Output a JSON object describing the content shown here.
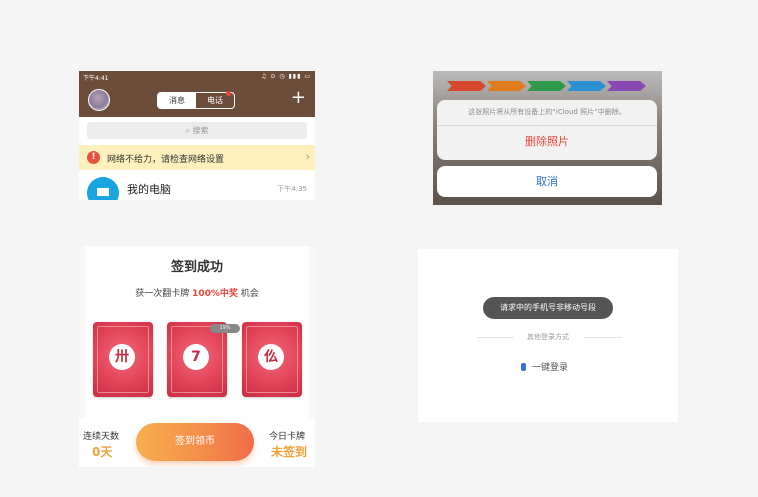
{
  "qq_panel": {
    "status_time": "下午4:41",
    "status_icons": "♫ ⊙ ◷ ▮▮▮ ▭",
    "tabs": [
      "消息",
      "电话"
    ],
    "plus_icon": "+",
    "search_placeholder": "搜索",
    "network_alert": "网络不给力，请检查网络设置",
    "alert_icon": "!",
    "alert_arrow": "›",
    "contact": {
      "name": "我的电脑",
      "time": "下午4:35"
    }
  },
  "photo_panel": {
    "process_colors": [
      "#d44a2a",
      "#e07b1e",
      "#2f9a4a",
      "#2b8fd1",
      "#8a48b4"
    ],
    "message": "这张照片将从所有设备上的“iCloud 照片”中删除。",
    "delete_label": "删除照片",
    "cancel_label": "取消"
  },
  "checkin_panel": {
    "title": "签到成功",
    "subtitle_prefix": "获一次翻卡牌",
    "subtitle_highlight": "100%中奖",
    "subtitle_suffix": "机会",
    "cards": [
      "卅",
      "7",
      "仫"
    ],
    "pct_badge": "19%",
    "streak_label": "连续天数",
    "streak_value": "0天",
    "checkin_button": "签到领币",
    "today_label": "今日卡牌",
    "today_value": "未签到"
  },
  "login_panel": {
    "toast": "请求中的手机号非移动号段",
    "other_methods": "其他登录方式",
    "one_key_login": "一键登录"
  }
}
